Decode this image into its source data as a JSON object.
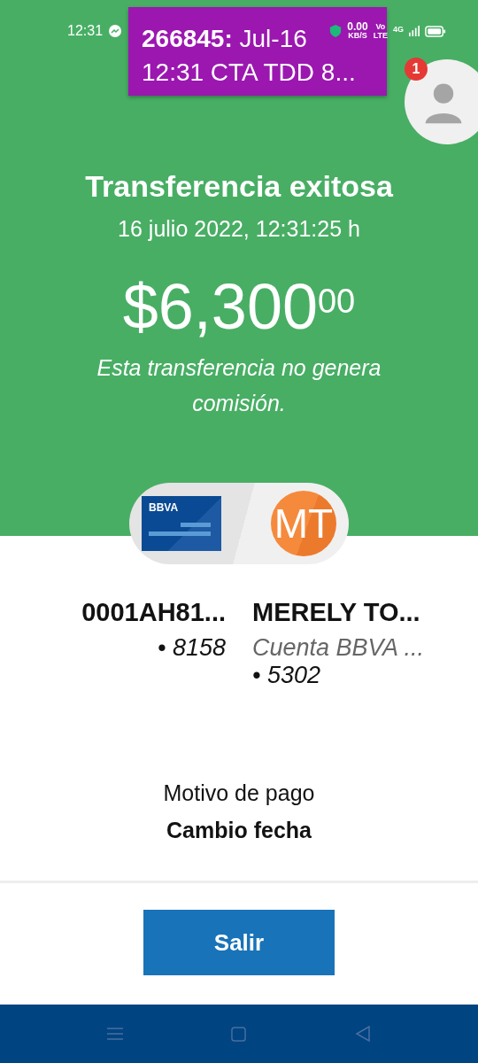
{
  "status_bar": {
    "time": "12:31",
    "speed": "0.00",
    "speed_unit": "KB/S",
    "volte_top": "Vo",
    "volte_bottom": "LTE",
    "network": "4G"
  },
  "notification": {
    "title": "**266845:** Jul-16",
    "text": "12:31 CTA TDD 8..."
  },
  "chat_bubble": {
    "badge": "1"
  },
  "header": {
    "title": "Transferencia exitosa",
    "date": "16 julio 2022, 12:31:25 h",
    "amount": "$6,300$^{00}$",
    "note": "Esta transferencia no genera comisión."
  },
  "origin": {
    "card_brand": "BBVA",
    "name": "0001AH81...",
    "number": "• 8158"
  },
  "destination": {
    "initials": "MT",
    "name": "MERELY TO...",
    "account": "Cuenta BBVA ...",
    "number": "• 5302"
  },
  "reason": {
    "label": "Motivo de pago",
    "value": "Cambio fecha"
  },
  "button": "Salir"
}
